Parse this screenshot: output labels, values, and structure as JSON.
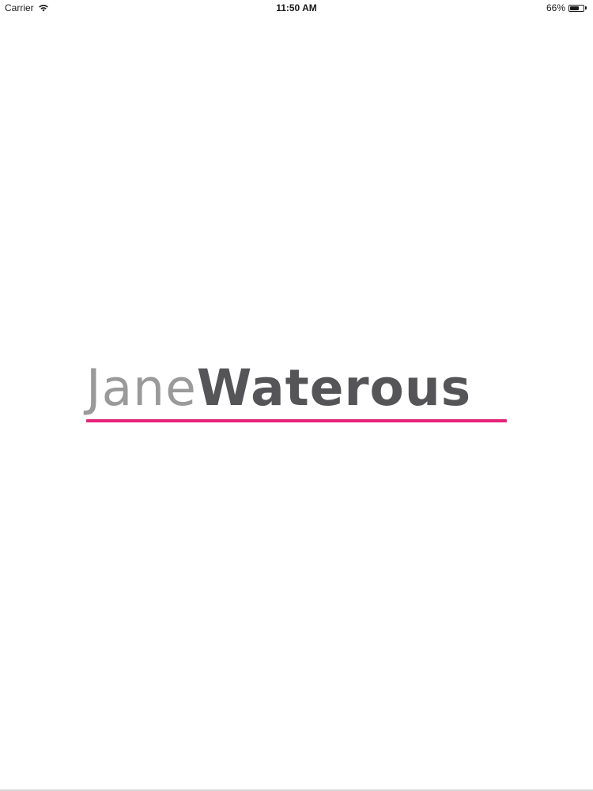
{
  "status_bar": {
    "carrier": "Carrier",
    "time": "11:50 AM",
    "battery_percent_label": "66%",
    "battery_level": 0.66,
    "wifi_icon": "wifi-icon",
    "battery_icon": "battery-icon"
  },
  "logo": {
    "first_name": "Jane",
    "last_name": "Waterous"
  },
  "colors": {
    "accent_underline": "#e4237a",
    "first_name": "#9a9a9a",
    "last_name": "#555558",
    "background": "#ffffff"
  }
}
